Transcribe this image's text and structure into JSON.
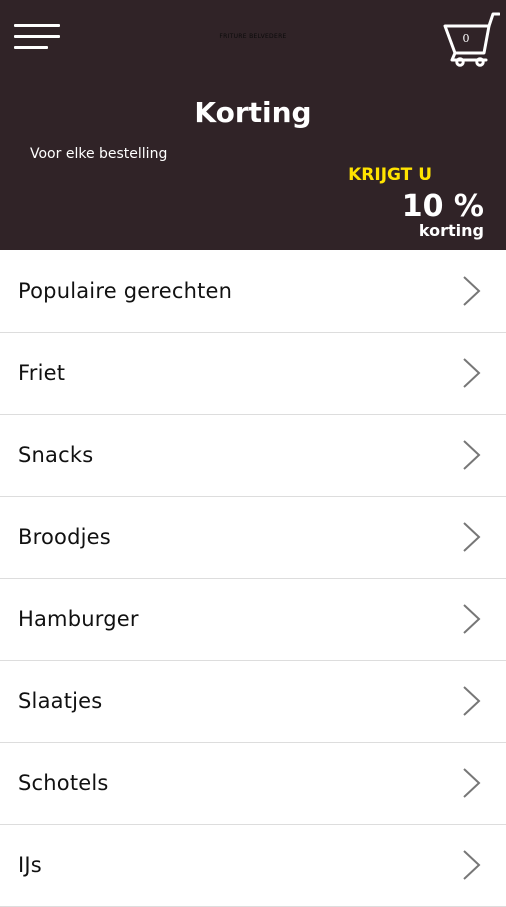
{
  "header": {
    "menu_icon": "hamburger-menu-icon",
    "brand": "FRITURE BELVEDERE",
    "cart_icon": "shopping-cart-icon",
    "cart_count": "0",
    "colors": {
      "bar": "#302327",
      "accent": "#ffe300"
    }
  },
  "promo": {
    "title": "Korting",
    "subtitle": "Voor elke bestelling",
    "krijgt": "KRIJGT U",
    "percent": "10 %",
    "korting": "korting"
  },
  "categories": [
    {
      "label": "Populaire gerechten"
    },
    {
      "label": "Friet"
    },
    {
      "label": "Snacks"
    },
    {
      "label": "Broodjes"
    },
    {
      "label": "Hamburger"
    },
    {
      "label": "Slaatjes"
    },
    {
      "label": "Schotels"
    },
    {
      "label": "IJs"
    }
  ]
}
